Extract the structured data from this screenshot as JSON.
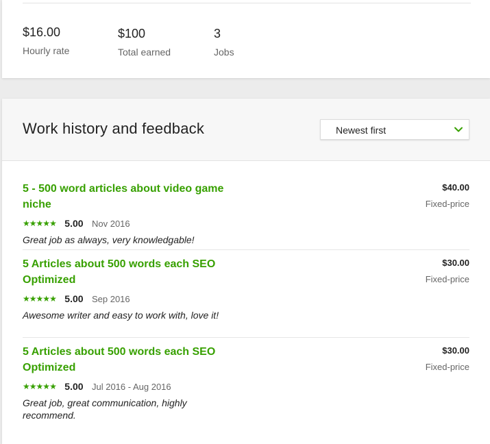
{
  "stats": {
    "hourly_rate_value": "$16.00",
    "hourly_rate_label": "Hourly rate",
    "total_earned_value": "$100",
    "total_earned_label": "Total earned",
    "jobs_value": "3",
    "jobs_label": "Jobs"
  },
  "history": {
    "title": "Work history and feedback",
    "sort_selected": "Newest first",
    "jobs": [
      {
        "title": "5 - 500 word articles about video game niche",
        "rating": "5.00",
        "date": "Nov 2016",
        "feedback": "Great job as always, very knowledgable!",
        "amount": "$40.00",
        "type": "Fixed-price"
      },
      {
        "title": "5 Articles about 500 words each SEO Optimized",
        "rating": "5.00",
        "date": "Sep 2016",
        "feedback": "Awesome writer and easy to work with, love it!",
        "amount": "$30.00",
        "type": "Fixed-price"
      },
      {
        "title": "5 Articles about 500 words each SEO Optimized",
        "rating": "5.00",
        "date": "Jul 2016 - Aug 2016",
        "feedback": "Great job, great communication, highly recommend.",
        "amount": "$30.00",
        "type": "Fixed-price"
      }
    ]
  },
  "colors": {
    "accent_green": "#37a000",
    "muted_text": "#656565"
  },
  "icons": {
    "sort_chevron": "chevron-down-icon",
    "star": "star-icon"
  }
}
